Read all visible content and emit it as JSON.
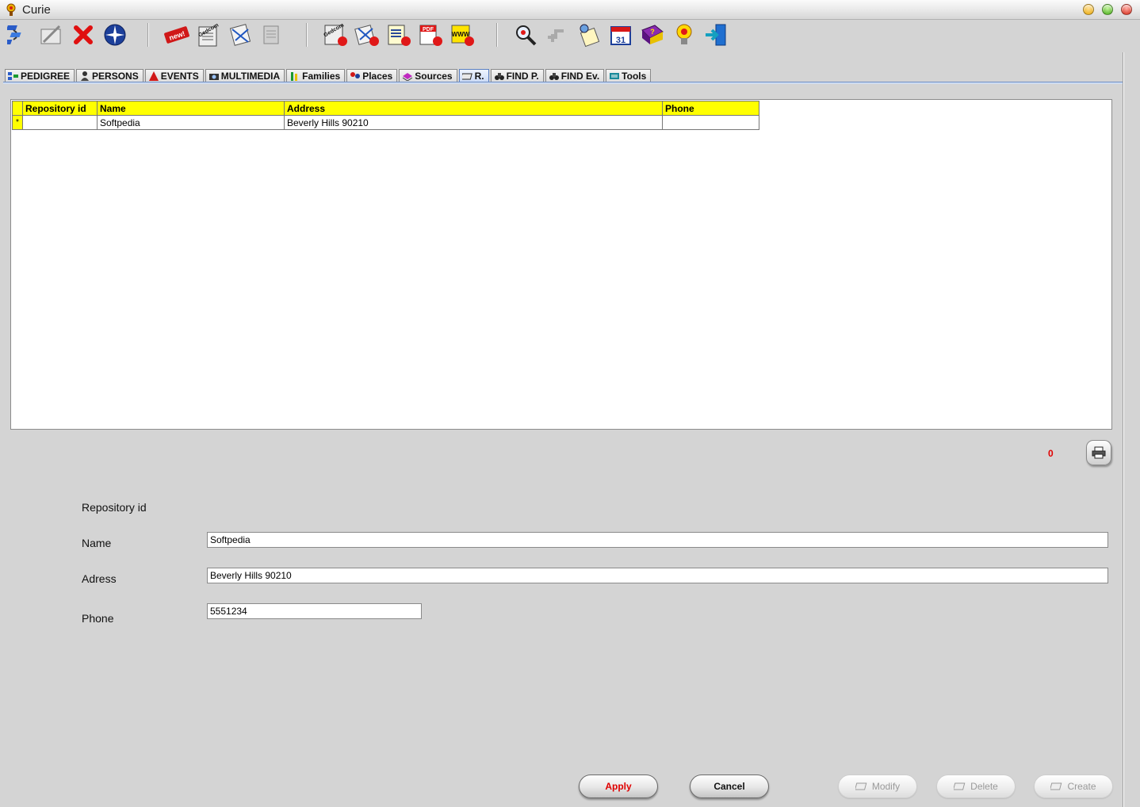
{
  "window": {
    "title": "Curie"
  },
  "toolbar": {
    "buttons": [
      {
        "icon": "tree-icon"
      },
      {
        "icon": "edit-pen-icon"
      },
      {
        "icon": "red-x-icon"
      },
      {
        "icon": "globe-icon"
      },
      {
        "icon": "new-badge-icon",
        "label": "new!"
      },
      {
        "icon": "gedcom-icon",
        "label": "Gedcom"
      },
      {
        "icon": "import-icon"
      },
      {
        "icon": "report-gray-icon"
      },
      {
        "icon": "gedcom-export-icon",
        "label": "Gedcom"
      },
      {
        "icon": "x-export-icon"
      },
      {
        "icon": "doc-export-icon"
      },
      {
        "icon": "pdf-export-icon",
        "label": "PDF"
      },
      {
        "icon": "www-export-icon",
        "label": "WWW"
      },
      {
        "icon": "search-icon"
      },
      {
        "icon": "links-icon"
      },
      {
        "icon": "scroll-icon"
      },
      {
        "icon": "calendar-icon",
        "label": "31"
      },
      {
        "icon": "help-book-icon",
        "label": "?"
      },
      {
        "icon": "lightbulb-icon"
      },
      {
        "icon": "exit-icon"
      }
    ]
  },
  "tabs": [
    {
      "label": "PEDIGREE",
      "icon": "pedigree-icon"
    },
    {
      "label": "PERSONS",
      "icon": "person-icon"
    },
    {
      "label": "EVENTS",
      "icon": "event-icon"
    },
    {
      "label": "MULTIMEDIA",
      "icon": "camera-icon"
    },
    {
      "label": "Families",
      "icon": "family-icon"
    },
    {
      "label": "Places",
      "icon": "places-icon"
    },
    {
      "label": "Sources",
      "icon": "sources-icon"
    },
    {
      "label": "R.",
      "icon": "repository-icon",
      "active": true
    },
    {
      "label": "FIND P.",
      "icon": "binoculars-icon"
    },
    {
      "label": "FIND Ev.",
      "icon": "binoculars-icon"
    },
    {
      "label": "Tools",
      "icon": "tools-icon"
    }
  ],
  "grid": {
    "columns": [
      "Repository id",
      "Name",
      "Address",
      "Phone"
    ],
    "rows": [
      {
        "indicator": "*",
        "cells": [
          "",
          "Softpedia",
          "Beverly Hills 90210",
          ""
        ]
      }
    ]
  },
  "record_count": "0",
  "form": {
    "repository_id_label": "Repository id",
    "name_label": "Name",
    "name_value": "Softpedia",
    "address_label": "Adress",
    "address_value": "Beverly Hills 90210",
    "phone_label": "Phone",
    "phone_value": "5551234"
  },
  "buttons": {
    "apply": "Apply",
    "cancel": "Cancel",
    "modify": "Modify",
    "delete": "Delete",
    "create": "Create"
  }
}
